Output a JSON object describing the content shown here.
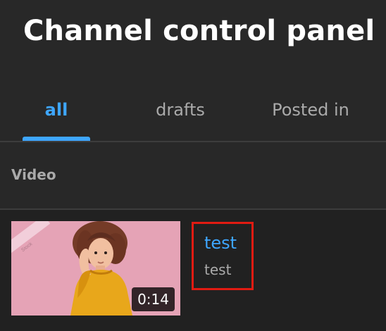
{
  "page": {
    "title": "Channel control panel"
  },
  "tabs": [
    {
      "label": "all",
      "active": true
    },
    {
      "label": "drafts",
      "active": false
    },
    {
      "label": "Posted in",
      "active": false
    }
  ],
  "section": {
    "label": "Video"
  },
  "video": {
    "title": "test",
    "description": "test",
    "duration": "0:14",
    "thumbnail_icon": "woman-thinking-thumbnail"
  },
  "colors": {
    "background": "#282828",
    "row_background": "#212121",
    "accent": "#3ea6ff",
    "muted_text": "#aaaaaa",
    "highlight_border": "#e11b12",
    "thumbnail_pink": "#e5a3b6"
  }
}
